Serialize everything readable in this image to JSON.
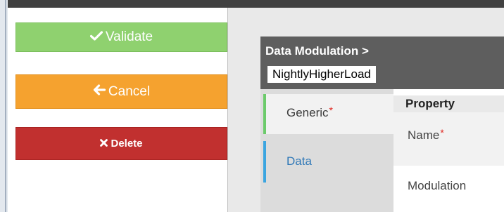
{
  "sidebar": {
    "validate_label": "Validate",
    "cancel_label": "Cancel",
    "delete_label": "Delete",
    "validate_icon": "checkmark-icon",
    "cancel_icon": "arrow-left-icon",
    "delete_icon": "x-icon"
  },
  "panel": {
    "breadcrumb": "Data Modulation >",
    "name_value": "NightlyHigherLoad"
  },
  "tabs": [
    {
      "label": "Generic",
      "required_marker": "*",
      "active": true
    },
    {
      "label": "Data",
      "active": false
    }
  ],
  "table": {
    "header": "Property",
    "rows": [
      {
        "label": "Name",
        "required_marker": "*"
      },
      {
        "label": "Modulation"
      }
    ]
  },
  "colors": {
    "validate": "#8fd16f",
    "cancel": "#f5a22f",
    "delete": "#c1302f",
    "tab_generic_accent": "#6ccb6b",
    "tab_data_accent": "#3ba5e0",
    "header_bg": "#5e5e5e"
  }
}
